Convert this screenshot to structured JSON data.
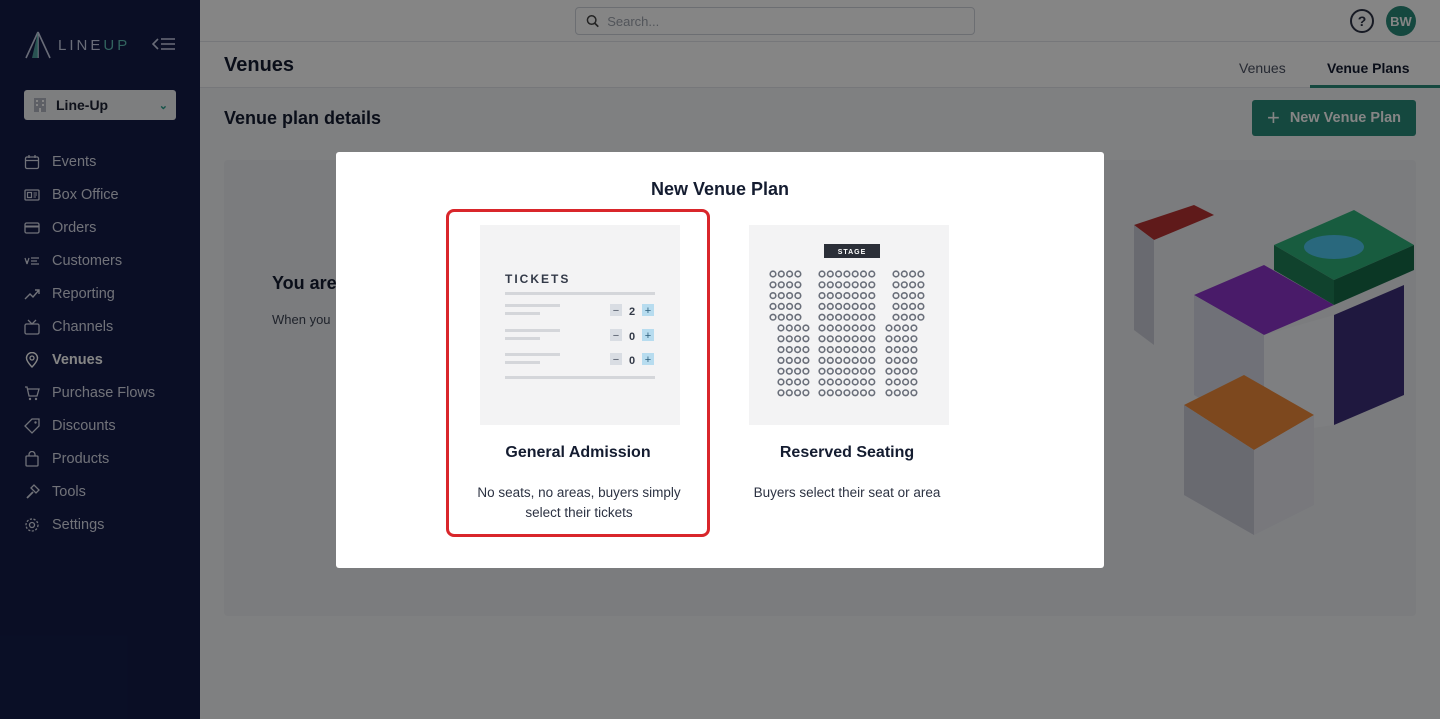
{
  "app": {
    "logo_text_main": "LINE",
    "logo_text_accent": "UP"
  },
  "org_select": {
    "value": "Line-Up"
  },
  "sidebar": {
    "items": [
      {
        "label": "Events",
        "icon": "calendar-icon"
      },
      {
        "label": "Box Office",
        "icon": "box-office-icon"
      },
      {
        "label": "Orders",
        "icon": "credit-card-icon"
      },
      {
        "label": "Customers",
        "icon": "customers-list-icon"
      },
      {
        "label": "Reporting",
        "icon": "trend-chart-icon"
      },
      {
        "label": "Channels",
        "icon": "tv-icon"
      },
      {
        "label": "Venues",
        "icon": "map-pin-icon",
        "active": true
      },
      {
        "label": "Purchase Flows",
        "icon": "cart-icon"
      },
      {
        "label": "Discounts",
        "icon": "tag-icon"
      },
      {
        "label": "Products",
        "icon": "bag-icon"
      },
      {
        "label": "Tools",
        "icon": "hammer-icon"
      },
      {
        "label": "Settings",
        "icon": "gear-icon"
      }
    ]
  },
  "topbar": {
    "search_placeholder": "Search...",
    "avatar_initials": "BW"
  },
  "header": {
    "title": "Venues",
    "tabs": [
      {
        "label": "Venues",
        "active": false
      },
      {
        "label": "Venue Plans",
        "active": true
      }
    ]
  },
  "main": {
    "section_title": "Venue plan details",
    "new_button_label": "New Venue Plan",
    "empty_title": "You are",
    "empty_text": "When you"
  },
  "modal": {
    "title": "New Venue Plan",
    "options": [
      {
        "title": "General Admission",
        "description": "No seats, no areas, buyers simply select their tickets",
        "thumb_heading": "TICKETS",
        "quantities": [
          "2",
          "0",
          "0"
        ],
        "selected": true
      },
      {
        "title": "Reserved Seating",
        "description": "Buyers select their seat or area",
        "stage_label": "STAGE"
      }
    ]
  },
  "colors": {
    "sidebar_bg": "#141c48",
    "accent": "#2a8a79",
    "highlight_border": "#d9262b"
  }
}
